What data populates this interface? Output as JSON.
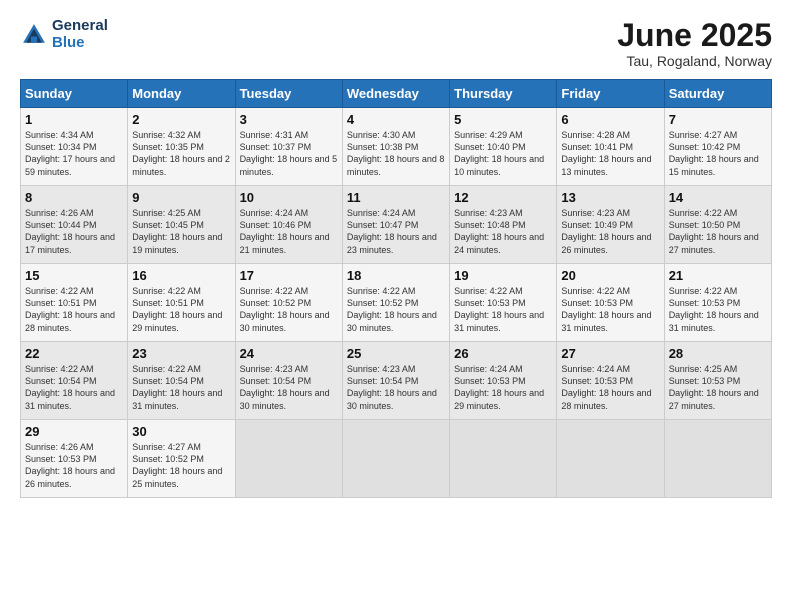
{
  "logo": {
    "line1": "General",
    "line2": "Blue"
  },
  "title": "June 2025",
  "subtitle": "Tau, Rogaland, Norway",
  "days": [
    "Sunday",
    "Monday",
    "Tuesday",
    "Wednesday",
    "Thursday",
    "Friday",
    "Saturday"
  ],
  "weeks": [
    [
      {
        "day": "1",
        "sunrise": "4:34 AM",
        "sunset": "10:34 PM",
        "daylight": "17 hours and 59 minutes."
      },
      {
        "day": "2",
        "sunrise": "4:32 AM",
        "sunset": "10:35 PM",
        "daylight": "18 hours and 2 minutes."
      },
      {
        "day": "3",
        "sunrise": "4:31 AM",
        "sunset": "10:37 PM",
        "daylight": "18 hours and 5 minutes."
      },
      {
        "day": "4",
        "sunrise": "4:30 AM",
        "sunset": "10:38 PM",
        "daylight": "18 hours and 8 minutes."
      },
      {
        "day": "5",
        "sunrise": "4:29 AM",
        "sunset": "10:40 PM",
        "daylight": "18 hours and 10 minutes."
      },
      {
        "day": "6",
        "sunrise": "4:28 AM",
        "sunset": "10:41 PM",
        "daylight": "18 hours and 13 minutes."
      },
      {
        "day": "7",
        "sunrise": "4:27 AM",
        "sunset": "10:42 PM",
        "daylight": "18 hours and 15 minutes."
      }
    ],
    [
      {
        "day": "8",
        "sunrise": "4:26 AM",
        "sunset": "10:44 PM",
        "daylight": "18 hours and 17 minutes."
      },
      {
        "day": "9",
        "sunrise": "4:25 AM",
        "sunset": "10:45 PM",
        "daylight": "18 hours and 19 minutes."
      },
      {
        "day": "10",
        "sunrise": "4:24 AM",
        "sunset": "10:46 PM",
        "daylight": "18 hours and 21 minutes."
      },
      {
        "day": "11",
        "sunrise": "4:24 AM",
        "sunset": "10:47 PM",
        "daylight": "18 hours and 23 minutes."
      },
      {
        "day": "12",
        "sunrise": "4:23 AM",
        "sunset": "10:48 PM",
        "daylight": "18 hours and 24 minutes."
      },
      {
        "day": "13",
        "sunrise": "4:23 AM",
        "sunset": "10:49 PM",
        "daylight": "18 hours and 26 minutes."
      },
      {
        "day": "14",
        "sunrise": "4:22 AM",
        "sunset": "10:50 PM",
        "daylight": "18 hours and 27 minutes."
      }
    ],
    [
      {
        "day": "15",
        "sunrise": "4:22 AM",
        "sunset": "10:51 PM",
        "daylight": "18 hours and 28 minutes."
      },
      {
        "day": "16",
        "sunrise": "4:22 AM",
        "sunset": "10:51 PM",
        "daylight": "18 hours and 29 minutes."
      },
      {
        "day": "17",
        "sunrise": "4:22 AM",
        "sunset": "10:52 PM",
        "daylight": "18 hours and 30 minutes."
      },
      {
        "day": "18",
        "sunrise": "4:22 AM",
        "sunset": "10:52 PM",
        "daylight": "18 hours and 30 minutes."
      },
      {
        "day": "19",
        "sunrise": "4:22 AM",
        "sunset": "10:53 PM",
        "daylight": "18 hours and 31 minutes."
      },
      {
        "day": "20",
        "sunrise": "4:22 AM",
        "sunset": "10:53 PM",
        "daylight": "18 hours and 31 minutes."
      },
      {
        "day": "21",
        "sunrise": "4:22 AM",
        "sunset": "10:53 PM",
        "daylight": "18 hours and 31 minutes."
      }
    ],
    [
      {
        "day": "22",
        "sunrise": "4:22 AM",
        "sunset": "10:54 PM",
        "daylight": "18 hours and 31 minutes."
      },
      {
        "day": "23",
        "sunrise": "4:22 AM",
        "sunset": "10:54 PM",
        "daylight": "18 hours and 31 minutes."
      },
      {
        "day": "24",
        "sunrise": "4:23 AM",
        "sunset": "10:54 PM",
        "daylight": "18 hours and 30 minutes."
      },
      {
        "day": "25",
        "sunrise": "4:23 AM",
        "sunset": "10:54 PM",
        "daylight": "18 hours and 30 minutes."
      },
      {
        "day": "26",
        "sunrise": "4:24 AM",
        "sunset": "10:53 PM",
        "daylight": "18 hours and 29 minutes."
      },
      {
        "day": "27",
        "sunrise": "4:24 AM",
        "sunset": "10:53 PM",
        "daylight": "18 hours and 28 minutes."
      },
      {
        "day": "28",
        "sunrise": "4:25 AM",
        "sunset": "10:53 PM",
        "daylight": "18 hours and 27 minutes."
      }
    ],
    [
      {
        "day": "29",
        "sunrise": "4:26 AM",
        "sunset": "10:53 PM",
        "daylight": "18 hours and 26 minutes."
      },
      {
        "day": "30",
        "sunrise": "4:27 AM",
        "sunset": "10:52 PM",
        "daylight": "18 hours and 25 minutes."
      },
      null,
      null,
      null,
      null,
      null
    ]
  ]
}
